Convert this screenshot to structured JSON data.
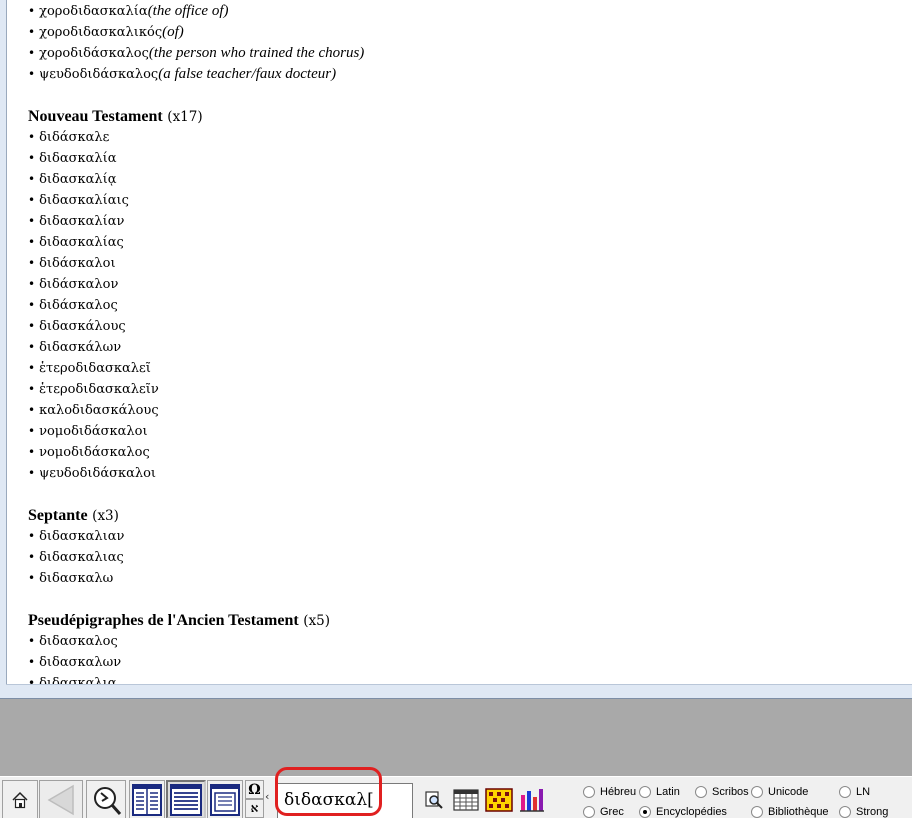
{
  "document": {
    "top_items": [
      {
        "greek": "χοροδιδασκαλία",
        "gloss": "(the office of)"
      },
      {
        "greek": "χοροδιδασκαλικός",
        "gloss": "(of)"
      },
      {
        "greek": "χοροδιδάσκαλος",
        "gloss": "(the person who trained the chorus)"
      },
      {
        "greek": "ψευδοδιδάσκαλος",
        "gloss": "(a false teacher/faux docteur)"
      }
    ],
    "sections": [
      {
        "title": "Nouveau Testament",
        "count": "(x17)",
        "items": [
          "διδάσκαλε",
          "διδασκαλία",
          "διδασκαλίᾳ",
          "διδασκαλίαις",
          "διδασκαλίαν",
          "διδασκαλίας",
          "διδάσκαλοι",
          "διδάσκαλον",
          "διδάσκαλος",
          "διδασκάλους",
          "διδασκάλων",
          "ἑτεροδιδασκαλεῖ",
          "ἑτεροδιδασκαλεῖν",
          "καλοδιδασκάλους",
          "νομοδιδάσκαλοι",
          "νομοδιδάσκαλος",
          "ψευδοδιδάσκαλοι"
        ]
      },
      {
        "title": "Septante",
        "count": "(x3)",
        "items": [
          "διδασκαλιαν",
          "διδασκαλιας",
          "διδασκαλω"
        ]
      },
      {
        "title": "Pseudépigraphes de l'Ancien Testament",
        "count": "(x5)",
        "items": [
          "διδασκαλος",
          "διδασκαλων",
          "διδασκαλια"
        ]
      }
    ]
  },
  "toolbar": {
    "search_value": "διδασκαλ[",
    "omega_label": "Ω",
    "aleph_label": "א",
    "arrow_label": "‹",
    "highlight_color": "#e02020",
    "radios": {
      "hebreu": "Hébreu",
      "latin": "Latin",
      "scribos": "Scribos",
      "unicode": "Unicode",
      "ln": "LN",
      "grec": "Grec",
      "encyclopedies": "Encyclopédies",
      "bibliotheque": "Bibliothèque",
      "strong": "Strong"
    },
    "selected_radio": "encyclopedies",
    "icons": [
      "home-icon",
      "back-arrow-icon",
      "compass-search-icon",
      "two-column-view-icon",
      "single-column-view-icon",
      "window-view-icon",
      "zoom-page-icon",
      "grid-table-icon",
      "colored-grid-icon",
      "bar-chart-icon"
    ]
  }
}
